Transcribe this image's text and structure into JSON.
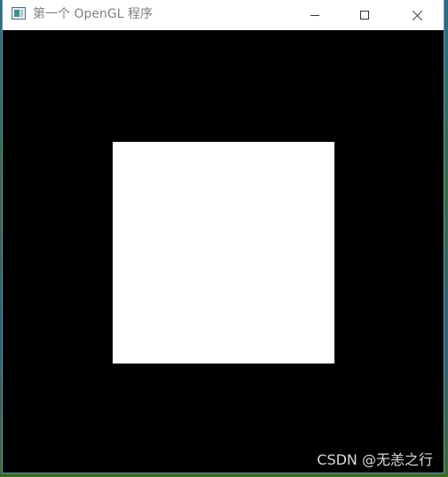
{
  "window": {
    "title": "第一个 OpenGL 程序",
    "icon": "opengl-app-icon"
  },
  "controls": {
    "minimize_icon": "minimize-icon",
    "maximize_icon": "maximize-icon",
    "close_icon": "close-icon"
  },
  "canvas": {
    "background_color": "#000000",
    "shape": "square",
    "shape_color": "#ffffff"
  },
  "watermark": "CSDN @无恙之行"
}
